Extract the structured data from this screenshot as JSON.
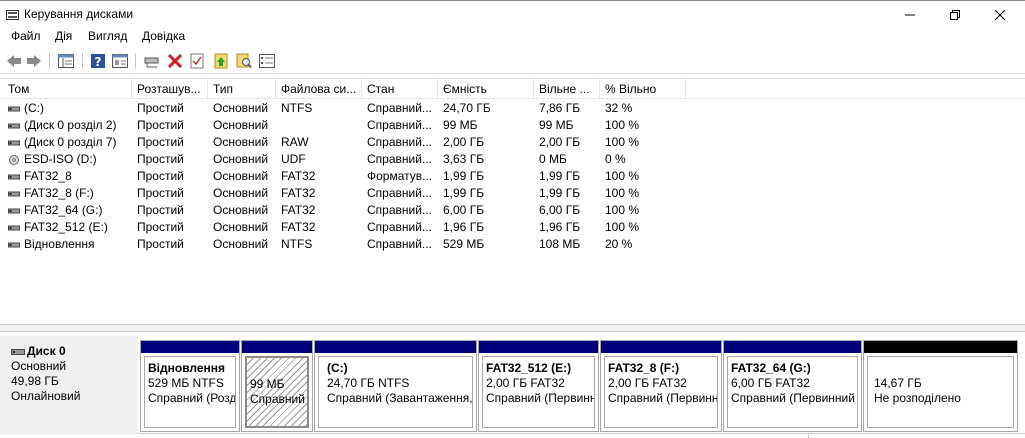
{
  "window": {
    "title": "Керування дисками",
    "controls": {
      "minimize": "minimize-icon",
      "maximize": "maximize-icon",
      "close": "close-icon"
    }
  },
  "menu": [
    "Файл",
    "Дія",
    "Вигляд",
    "Довідка"
  ],
  "toolbar": {
    "icons": [
      "back-icon",
      "forward-icon",
      "console-tree-icon",
      "help-icon",
      "properties-icon",
      "connect-drive-icon",
      "delete-icon",
      "check-icon",
      "import-icon",
      "search-icon",
      "list-view-icon"
    ]
  },
  "volumes": {
    "columns": [
      "Том",
      "Розташув...",
      "Тип",
      "Файлова си...",
      "Стан",
      "Ємність",
      "Вільне ...",
      "% Вільно"
    ],
    "rows": [
      {
        "icon": "volume-icon",
        "name": "(C:)",
        "layout": "Простий",
        "type": "Основний",
        "fs": "NTFS",
        "status": "Справний...",
        "capacity": "24,70 ГБ",
        "free": "7,86 ГБ",
        "pct": "32 %"
      },
      {
        "icon": "volume-icon",
        "name": "(Диск 0 розділ 2)",
        "layout": "Простий",
        "type": "Основний",
        "fs": "",
        "status": "Справний...",
        "capacity": "99 МБ",
        "free": "99 МБ",
        "pct": "100 %"
      },
      {
        "icon": "volume-icon",
        "name": "(Диск 0 розділ 7)",
        "layout": "Простий",
        "type": "Основний",
        "fs": "RAW",
        "status": "Справний...",
        "capacity": "2,00 ГБ",
        "free": "2,00 ГБ",
        "pct": "100 %"
      },
      {
        "icon": "optical-disc-icon",
        "name": "ESD-ISO (D:)",
        "layout": "Простий",
        "type": "Основний",
        "fs": "UDF",
        "status": "Справний...",
        "capacity": "3,63 ГБ",
        "free": "0 МБ",
        "pct": "0 %"
      },
      {
        "icon": "volume-icon",
        "name": "FAT32_8",
        "layout": "Простий",
        "type": "Основний",
        "fs": "FAT32",
        "status": "Форматув...",
        "capacity": "1,99 ГБ",
        "free": "1,99 ГБ",
        "pct": "100 %"
      },
      {
        "icon": "volume-icon",
        "name": "FAT32_8 (F:)",
        "layout": "Простий",
        "type": "Основний",
        "fs": "FAT32",
        "status": "Справний...",
        "capacity": "1,99 ГБ",
        "free": "1,99 ГБ",
        "pct": "100 %"
      },
      {
        "icon": "volume-icon",
        "name": "FAT32_64 (G:)",
        "layout": "Простий",
        "type": "Основний",
        "fs": "FAT32",
        "status": "Справний...",
        "capacity": "6,00 ГБ",
        "free": "6,00 ГБ",
        "pct": "100 %"
      },
      {
        "icon": "volume-icon",
        "name": "FAT32_512 (E:)",
        "layout": "Простий",
        "type": "Основний",
        "fs": "FAT32",
        "status": "Справний...",
        "capacity": "1,96 ГБ",
        "free": "1,96 ГБ",
        "pct": "100 %"
      },
      {
        "icon": "volume-icon",
        "name": "Відновлення",
        "layout": "Простий",
        "type": "Основний",
        "fs": "NTFS",
        "status": "Справний...",
        "capacity": "529 МБ",
        "free": "108 МБ",
        "pct": "20 %"
      }
    ]
  },
  "disk": {
    "icon": "disk-icon",
    "name": "Диск 0",
    "type": "Основний",
    "size": "49,98 ГБ",
    "status": "Онлайновий",
    "partitions": [
      {
        "name": "Відновлення",
        "size": "529 МБ NTFS",
        "status": "Справний (Розділ"
      },
      {
        "name": "",
        "size": "99 МБ",
        "status": "Справний"
      },
      {
        "name": "(C:)",
        "size": "24,70 ГБ NTFS",
        "status": "Справний (Завантаження, С"
      },
      {
        "name": "FAT32_512  (E:)",
        "size": "2,00 ГБ FAT32",
        "status": "Справний (Первинний"
      },
      {
        "name": "FAT32_8  (F:)",
        "size": "2,00 ГБ FAT32",
        "status": "Справний (Первинний"
      },
      {
        "name": "FAT32_64  (G:)",
        "size": "6,00 ГБ FAT32",
        "status": "Справний (Первинний"
      },
      {
        "name": "",
        "size": "14,67 ГБ",
        "status": "Не розподілено"
      }
    ]
  },
  "colors": {
    "primary_partition": "#00007f",
    "unallocated": "#000000"
  }
}
